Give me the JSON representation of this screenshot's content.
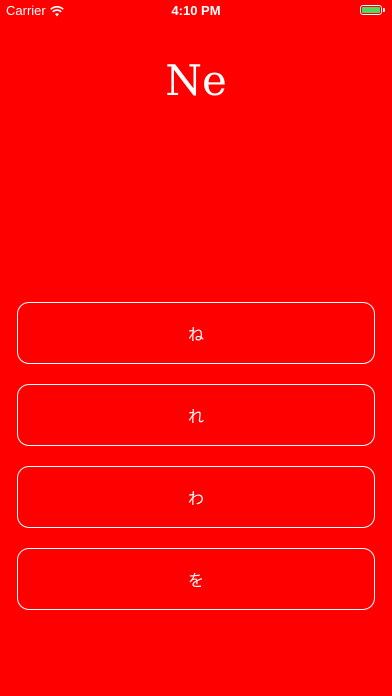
{
  "status_bar": {
    "carrier": "Carrier",
    "time": "4:10 PM",
    "battery_color": "#4cd964"
  },
  "question": {
    "romaji": "Ne"
  },
  "options": [
    {
      "label": "ね"
    },
    {
      "label": "れ"
    },
    {
      "label": "わ"
    },
    {
      "label": "を"
    }
  ],
  "colors": {
    "background": "#fe0000",
    "foreground": "#ffffff"
  }
}
